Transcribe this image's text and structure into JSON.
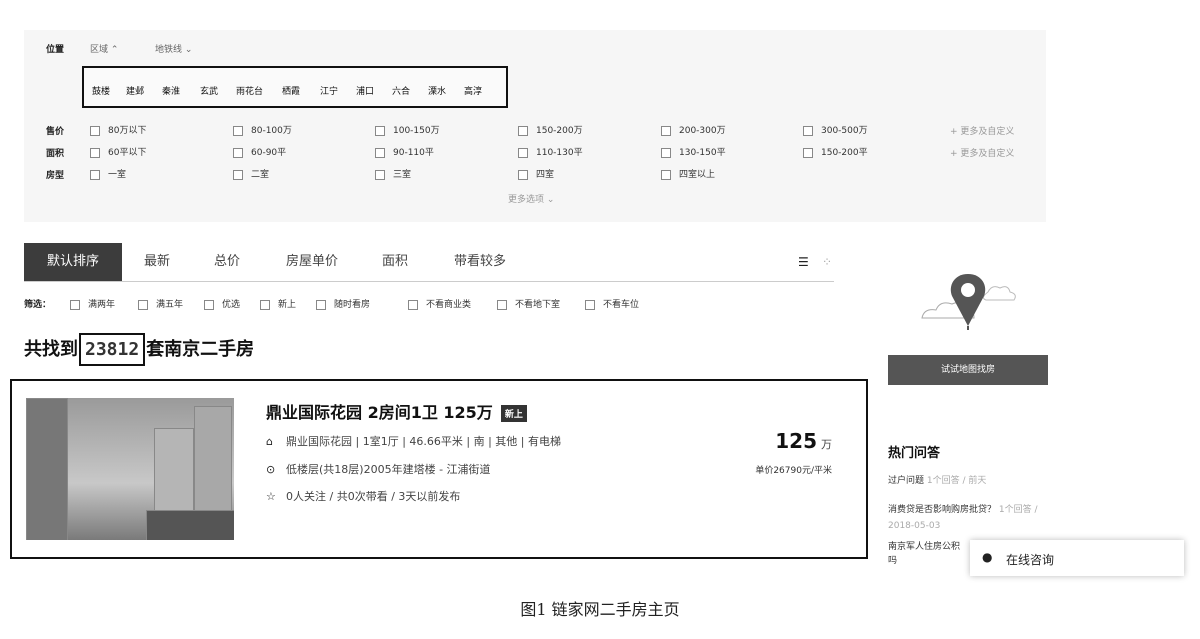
{
  "filters": {
    "location_label": "位置",
    "area_tab": "区域",
    "metro_tab": "地铁线",
    "districts": [
      "鼓楼",
      "建邺",
      "秦淮",
      "玄武",
      "雨花台",
      "栖霞",
      "江宁",
      "浦口",
      "六合",
      "溧水",
      "高淳"
    ],
    "price_label": "售价",
    "price_options": [
      "80万以下",
      "80-100万",
      "100-150万",
      "150-200万",
      "200-300万",
      "300-500万"
    ],
    "area_label": "面积",
    "area_options": [
      "60平以下",
      "60-90平",
      "90-110平",
      "110-130平",
      "130-150平",
      "150-200平"
    ],
    "layout_label": "房型",
    "layout_options": [
      "一室",
      "二室",
      "三室",
      "四室",
      "四室以上"
    ],
    "more_custom": "+ 更多及自定义",
    "more_options": "更多选项"
  },
  "sort": {
    "tabs": [
      "默认排序",
      "最新",
      "总价",
      "房屋单价",
      "面积",
      "带看较多"
    ]
  },
  "screen": {
    "label": "筛选：",
    "options": [
      "满两年",
      "满五年",
      "优选",
      "新上",
      "随时看房",
      "不看商业类",
      "不看地下室",
      "不看车位"
    ]
  },
  "result": {
    "prefix": "共找到",
    "count": "23812",
    "suffix": "套南京二手房"
  },
  "listing": {
    "title": "鼎业国际花园 2房间1卫 125万",
    "tag": "新上",
    "info": "鼎业国际花园 | 1室1厅 | 46.66平米 | 南 | 其他 | 有电梯",
    "floor": "低楼层(共18层)2005年建塔楼 - 江浦街道",
    "follow": "0人关注 / 共0次带看 / 3天以前发布",
    "price": "125",
    "price_unit": "万",
    "unit_price": "单价26790元/平米"
  },
  "sidebar": {
    "map_button": "试试地图找房",
    "hot_title": "热门问答",
    "q1": "过户问题",
    "q1_meta": "1个回答 / 前天",
    "q2": "消费贷是否影响购房批贷？",
    "q2_meta": "1个回答 / 2018-05-03",
    "q3": "南京军人住房公积",
    "q3b": "吗",
    "consult": "在线咨询"
  },
  "caption": "图1   链家网二手房主页"
}
